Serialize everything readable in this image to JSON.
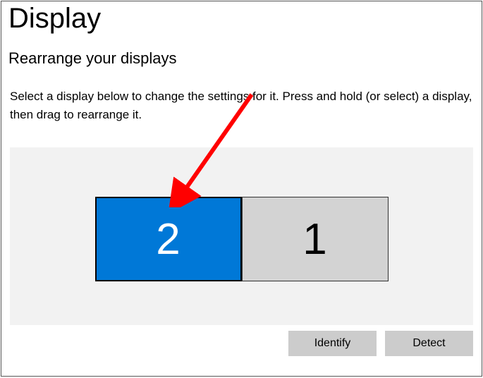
{
  "header": {
    "title": "Display"
  },
  "section": {
    "title": "Rearrange your displays",
    "description": "Select a display below to change the settings for it. Press and hold (or select) a display, then drag to rearrange it."
  },
  "displays": [
    {
      "label": "2",
      "selected": true
    },
    {
      "label": "1",
      "selected": false
    }
  ],
  "buttons": {
    "identify": "Identify",
    "detect": "Detect"
  },
  "colors": {
    "accent": "#0078d7",
    "panel": "#f2f2f2",
    "button": "#cccccc",
    "unselected_display": "#d3d3d3"
  }
}
